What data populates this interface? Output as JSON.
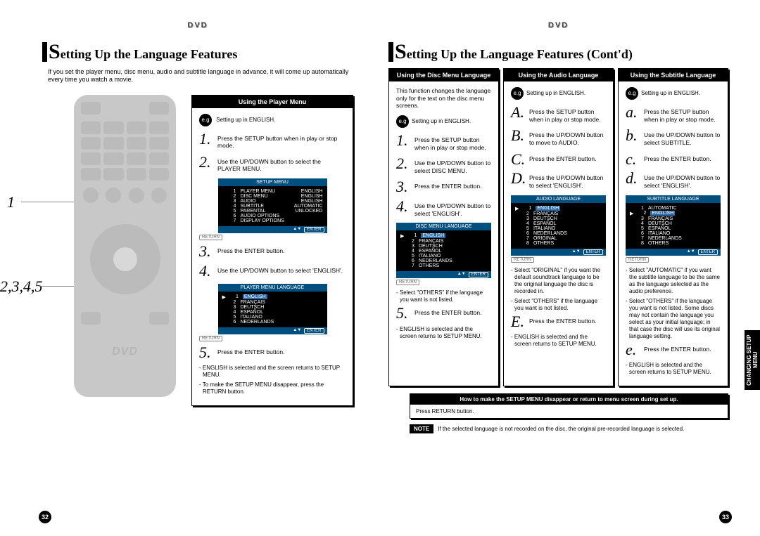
{
  "dvd_tag": "DVD",
  "left": {
    "title_prefix": "S",
    "title_rest": "etting Up the Language Features",
    "intro": "If you set the player menu, disc menu, audio and subtitle language in advance, it will come up automatically every time you watch a movie.",
    "callout1": "1",
    "callout2": "2,3,4,5",
    "dvd_logo": "DVD",
    "panel": {
      "title": "Using the Player Menu",
      "eg": "e.g",
      "eg_text": "Setting up in ENGLISH.",
      "steps": {
        "s1": {
          "n": "1.",
          "t": "Press the SETUP button when in play or stop mode."
        },
        "s2": {
          "n": "2.",
          "t": "Use the UP/DOWN button to select the PLAYER MENU."
        },
        "s3": {
          "n": "3.",
          "t": "Press the ENTER button."
        },
        "s4": {
          "n": "4.",
          "t": "Use the UP/DOWN button to select 'ENGLISH'."
        },
        "s5": {
          "n": "5.",
          "t": "Press the ENTER button."
        }
      },
      "osd1_title": "SETUP MENU",
      "osd1_rows": [
        {
          "i": "1",
          "l": "PLAYER MENU",
          "v": "ENGLISH"
        },
        {
          "i": "2",
          "l": "DISC MENU",
          "v": "ENGLISH"
        },
        {
          "i": "3",
          "l": "AUDIO",
          "v": "ENGLISH"
        },
        {
          "i": "4",
          "l": "SUBTITLE",
          "v": "AUTOMATIC"
        },
        {
          "i": "5",
          "l": "PARENTAL",
          "v": "UNLOCKED"
        },
        {
          "i": "6",
          "l": "AUDIO OPTIONS",
          "v": ""
        },
        {
          "i": "7",
          "l": "DISPLAY OPTIONS",
          "v": ""
        }
      ],
      "osd2_title": "PLAYER MENU LANGUAGE",
      "osd2_rows": [
        {
          "i": "1",
          "l": "ENGLISH"
        },
        {
          "i": "2",
          "l": "FRANÇAIS"
        },
        {
          "i": "3",
          "l": "DEUTSCH"
        },
        {
          "i": "4",
          "l": "ESPAÑOL"
        },
        {
          "i": "5",
          "l": "ITALIANO"
        },
        {
          "i": "6",
          "l": "NEDERLANDS"
        }
      ],
      "return": "RETURN",
      "enter": "ENTER",
      "notes": [
        "- ENGLISH is selected and the screen returns to SETUP MENU.",
        "- To make the SETUP MENU disappear, press the RETURN button."
      ]
    },
    "page_num": "32"
  },
  "right": {
    "title_prefix": "S",
    "title_rest": "etting Up the Language Features (Cont'd)",
    "disc": {
      "title": "Using the Disc Menu Language",
      "desc": "This function changes the language only for the text on the disc menu screens.",
      "eg": "e.g",
      "eg_text": "Setting up in ENGLISH.",
      "steps": {
        "s1": {
          "n": "1.",
          "t": "Press the SETUP button when in play or stop mode."
        },
        "s2": {
          "n": "2.",
          "t": "Use the UP/DOWN button to select DISC MENU."
        },
        "s3": {
          "n": "3.",
          "t": "Press the ENTER button."
        },
        "s4": {
          "n": "4.",
          "t": "Use the UP/DOWN button to select 'ENGLISH'."
        },
        "s5": {
          "n": "5.",
          "t": "Press the ENTER button."
        }
      },
      "osd_title": "DISC MENU LANGUAGE",
      "osd_rows": [
        {
          "i": "1",
          "l": "ENGLISH"
        },
        {
          "i": "2",
          "l": "FRANÇAIS"
        },
        {
          "i": "3",
          "l": "DEUTSCH"
        },
        {
          "i": "4",
          "l": "ESPAÑOL"
        },
        {
          "i": "5",
          "l": "ITALIANO"
        },
        {
          "i": "6",
          "l": "NEDERLANDS"
        },
        {
          "i": "7",
          "l": "OTHERS"
        }
      ],
      "notes": [
        "- Select \"OTHERS\" if the language you want is not listed.",
        "- ENGLISH is selected and the screen returns to SETUP MENU."
      ]
    },
    "audio": {
      "title": "Using the Audio Language",
      "eg": "e.g",
      "eg_text": "Setting up in ENGLISH.",
      "steps": {
        "sA": {
          "n": "A.",
          "t": "Press the SETUP button when in play or stop mode."
        },
        "sB": {
          "n": "B.",
          "t": "Press the UP/DOWN button to move to AUDIO."
        },
        "sC": {
          "n": "C.",
          "t": "Press the ENTER button."
        },
        "sD": {
          "n": "D.",
          "t": "Press the UP/DOWN button to select 'ENGLISH'."
        },
        "sE": {
          "n": "E.",
          "t": "Press the ENTER button."
        }
      },
      "osd_title": "AUDIO LANGUAGE",
      "osd_rows": [
        {
          "i": "1",
          "l": "ENGLISH"
        },
        {
          "i": "2",
          "l": "FRANÇAIS"
        },
        {
          "i": "3",
          "l": "DEUTSCH"
        },
        {
          "i": "4",
          "l": "ESPAÑOL"
        },
        {
          "i": "5",
          "l": "ITALIANO"
        },
        {
          "i": "6",
          "l": "NEDERLANDS"
        },
        {
          "i": "7",
          "l": "ORIGINAL"
        },
        {
          "i": "8",
          "l": "OTHERS"
        }
      ],
      "notes": [
        "- Select \"ORIGINAL\" if you want the default soundtrack language to be the original language the disc is recorded in.",
        "- Select \"OTHERS\" if the language you want is not listed.",
        "- ENGLISH is selected and the screen returns to SETUP MENU."
      ]
    },
    "subtitle": {
      "title": "Using the Subtitle Language",
      "eg": "e.g",
      "eg_text": "Setting up in ENGLISH.",
      "steps": {
        "sa": {
          "n": "a.",
          "t": "Press the SETUP button when in play or stop mode."
        },
        "sb": {
          "n": "b.",
          "t": "Use the UP/DOWN button to select SUBTITLE."
        },
        "sc": {
          "n": "c.",
          "t": "Press the ENTER button."
        },
        "sd": {
          "n": "d.",
          "t": "Use the UP/DOWN button to select 'ENGLISH'."
        },
        "se": {
          "n": "e.",
          "t": "Press the ENTER button."
        }
      },
      "osd_title": "SUBTITLE LANGUAGE",
      "osd_rows": [
        {
          "i": "1",
          "l": "AUTOMATIC"
        },
        {
          "i": "2",
          "l": "ENGLISH"
        },
        {
          "i": "3",
          "l": "FRANÇAIS"
        },
        {
          "i": "4",
          "l": "DEUTSCH"
        },
        {
          "i": "5",
          "l": "ESPAÑOL"
        },
        {
          "i": "6",
          "l": "ITALIANO"
        },
        {
          "i": "7",
          "l": "NEDERLANDS"
        },
        {
          "i": "8",
          "l": "OTHERS"
        }
      ],
      "notes": [
        "- Select \"AUTOMATIC\" if you want the subtitle language to be the same as the language selected as the audio preference.",
        "- Select \"OTHERS\" if the language you want is not listed. Some discs may not contain the language you select as your initial language; in that case the disc will use its original language setting.",
        "- ENGLISH is selected and the screen returns to SETUP MENU."
      ]
    },
    "howto_head": "How to make the SETUP MENU disappear or return to menu screen during set up.",
    "howto_body": "Press RETURN button.",
    "note_tag": "NOTE",
    "note_text": "If the selected language is not recorded on the disc, the original pre-recorded language is selected.",
    "side_tab": "CHANGING SETUP MENU",
    "page_num": "33"
  }
}
